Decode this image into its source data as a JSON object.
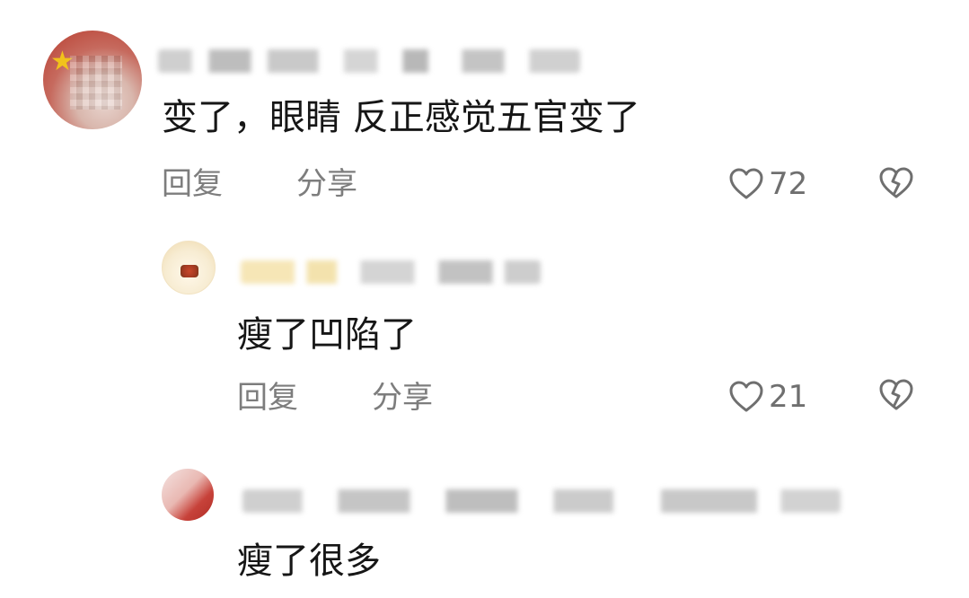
{
  "comments": [
    {
      "text": "变了，眼睛 反正感觉五官变了",
      "reply_label": "回复",
      "share_label": "分享",
      "likes": "72",
      "avatar_icon": "avatar-red-flag-icon"
    },
    {
      "text": "瘦了凹陷了",
      "reply_label": "回复",
      "share_label": "分享",
      "likes": "21",
      "avatar_icon": "avatar-food-icon"
    },
    {
      "text": "瘦了很多",
      "avatar_icon": "avatar-red-icon"
    }
  ],
  "colors": {
    "text": "#161616",
    "action": "#7d7d7d",
    "accent_red": "#c7423a"
  }
}
